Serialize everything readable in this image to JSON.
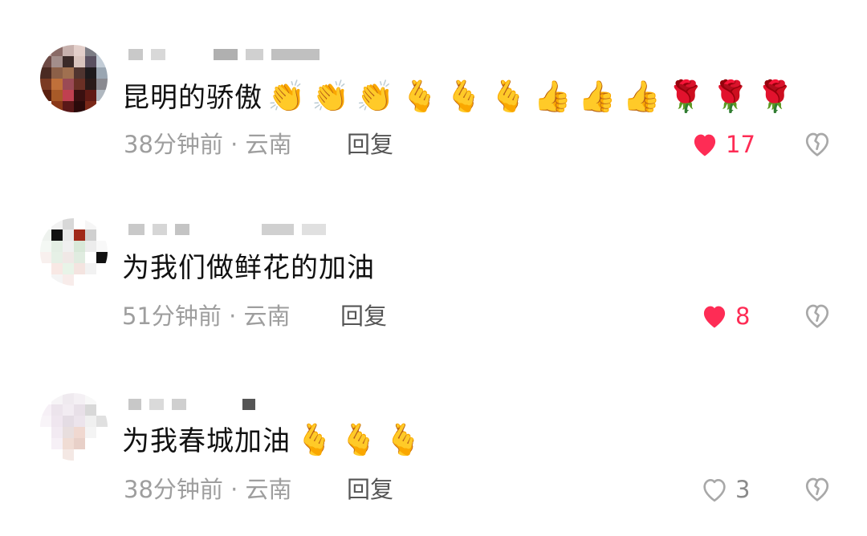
{
  "colors": {
    "accent": "#fe2c55",
    "meta": "#9e9e9e",
    "text": "#111111",
    "reply": "#555555"
  },
  "comments": [
    {
      "text": "昆明的骄傲",
      "emojis": "👏👏👏🫰🫰🫰👍👍👍🌹🌹🌹",
      "time": "38分钟前",
      "location": "· 云南",
      "reply_label": "回复",
      "likes": "17",
      "liked": true
    },
    {
      "text": "为我们做鲜花的加油",
      "emojis": "",
      "time": "51分钟前",
      "location": "· 云南",
      "reply_label": "回复",
      "likes": "8",
      "liked": true
    },
    {
      "text": "为我春城加油",
      "emojis": "🫰🫰🫰",
      "time": "38分钟前",
      "location": "· 云南",
      "reply_label": "回复",
      "likes": "3",
      "liked": false
    }
  ]
}
